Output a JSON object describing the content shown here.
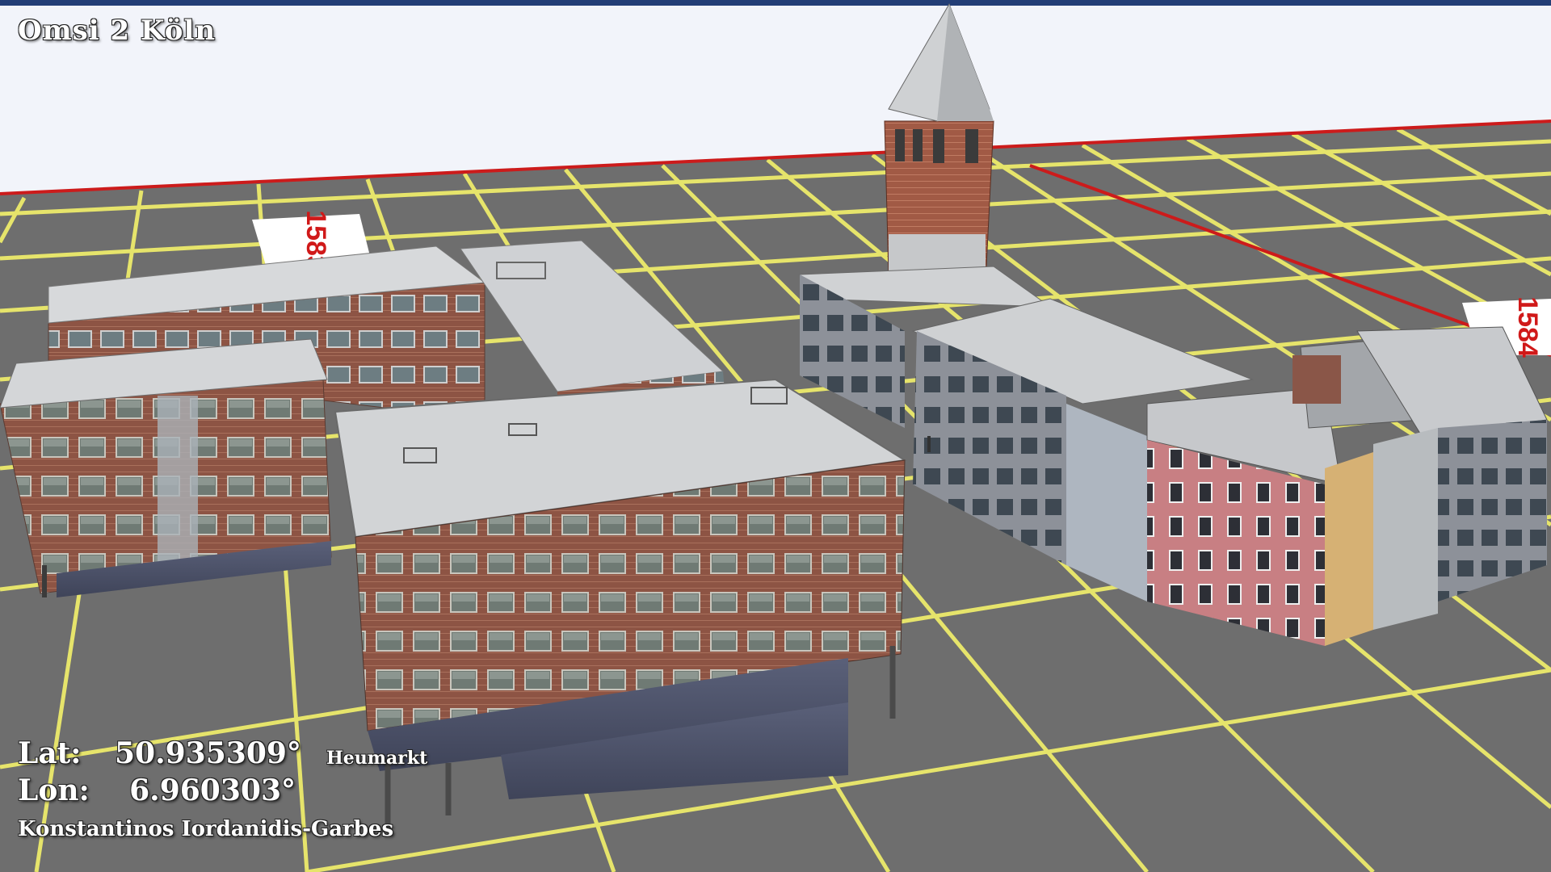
{
  "overlay": {
    "title": "Omsi 2 Köln",
    "lat_label": "Lat:",
    "lat_value": "50.935309°",
    "lon_label": "Lon:",
    "lon_value": "6.960303°",
    "place": "Heumarkt",
    "author": "Konstantinos Iordanidis-Garbes"
  },
  "markers": {
    "left": "1583",
    "right": "1584"
  },
  "colors": {
    "sky": "#f2f4fa",
    "ground": "#6f6f6f",
    "grid": "#e7e56a",
    "border_line": "#cc1b1b",
    "snow_roof": "#d6d8da",
    "brick": "#8a4f3f",
    "pink_facade": "#c77b7f",
    "top_bar": "#233e76"
  }
}
